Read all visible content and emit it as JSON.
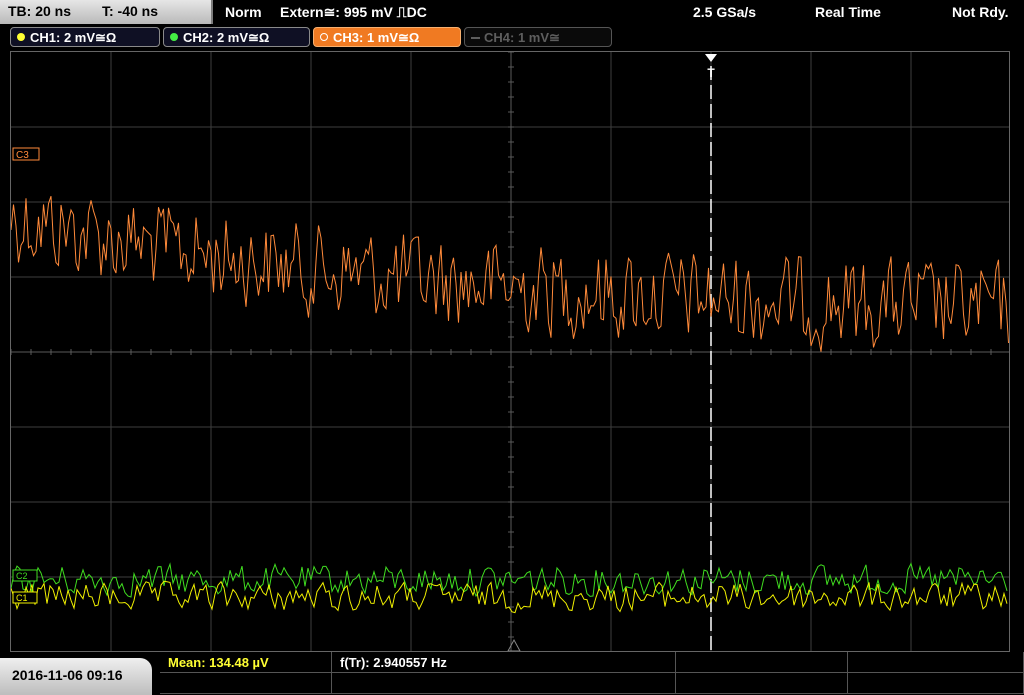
{
  "status": {
    "timebase": "TB: 20 ns",
    "trigger_time": "T: -40 ns",
    "mode": "Norm",
    "trigger_source": "Extern≅: 995 mV ⎍DC",
    "sample_rate": "2.5 GSa/s",
    "acq_mode": "Real Time",
    "state": "Not Rdy."
  },
  "channels": [
    {
      "label": "CH1: 2 mV≅Ω",
      "color": "#ffff00",
      "state": "on"
    },
    {
      "label": "CH2: 2 mV≅Ω",
      "color": "#33dd33",
      "state": "on"
    },
    {
      "label": "CH3: 1 mV≅Ω",
      "color": "#ff8c33",
      "state": "active"
    },
    {
      "label": "CH4: 1 mV≅",
      "color": "#5e5e5e",
      "state": "off"
    }
  ],
  "markers": {
    "ch3": "C3",
    "ch2": "C2",
    "ch1": "C1",
    "trigger": "T"
  },
  "measurements": {
    "mean": "Mean: 134.48 µV",
    "freq": "f(Tr): 2.940557 Hz"
  },
  "timestamp": "2016-11-06 09:16",
  "colors": {
    "ch1": "#f0f000",
    "ch2": "#40dd20",
    "ch3": "#ff8a3a",
    "grid": "#4a4a4a",
    "trigger_line": "#ffffff"
  }
}
